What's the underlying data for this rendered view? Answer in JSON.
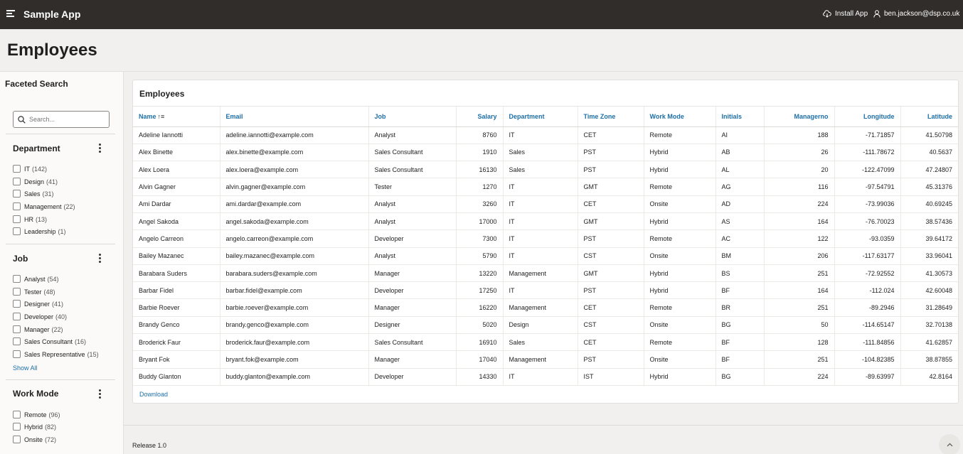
{
  "app": {
    "title": "Sample App",
    "install_label": "Install App",
    "user_email": "ben.jackson@dsp.co.uk"
  },
  "page": {
    "title": "Employees"
  },
  "sidebar": {
    "title": "Faceted Search",
    "search_placeholder": "Search...",
    "facets": [
      {
        "name": "Department",
        "options": [
          {
            "label": "IT",
            "count": "(142)"
          },
          {
            "label": "Design",
            "count": "(41)"
          },
          {
            "label": "Sales",
            "count": "(31)"
          },
          {
            "label": "Management",
            "count": "(22)"
          },
          {
            "label": "HR",
            "count": "(13)"
          },
          {
            "label": "Leadership",
            "count": "(1)"
          }
        ]
      },
      {
        "name": "Job",
        "options": [
          {
            "label": "Analyst",
            "count": "(54)"
          },
          {
            "label": "Tester",
            "count": "(48)"
          },
          {
            "label": "Designer",
            "count": "(41)"
          },
          {
            "label": "Developer",
            "count": "(40)"
          },
          {
            "label": "Manager",
            "count": "(22)"
          },
          {
            "label": "Sales Consultant",
            "count": "(16)"
          },
          {
            "label": "Sales Representative",
            "count": "(15)"
          }
        ],
        "show_all": "Show All"
      },
      {
        "name": "Work Mode",
        "options": [
          {
            "label": "Remote",
            "count": "(96)"
          },
          {
            "label": "Hybrid",
            "count": "(82)"
          },
          {
            "label": "Onsite",
            "count": "(72)"
          }
        ]
      }
    ]
  },
  "report": {
    "title": "Employees",
    "columns": [
      "Name",
      "Email",
      "Job",
      "Salary",
      "Department",
      "Time Zone",
      "Work Mode",
      "Initials",
      "Managerno",
      "Longitude",
      "Latitude"
    ],
    "rows": [
      [
        "Adeline Iannotti",
        "adeline.iannotti@example.com",
        "Analyst",
        "8760",
        "IT",
        "CET",
        "Remote",
        "AI",
        "188",
        "-71.71857",
        "41.50798"
      ],
      [
        "Alex Binette",
        "alex.binette@example.com",
        "Sales Consultant",
        "1910",
        "Sales",
        "PST",
        "Hybrid",
        "AB",
        "26",
        "-111.78672",
        "40.5637"
      ],
      [
        "Alex Loera",
        "alex.loera@example.com",
        "Sales Consultant",
        "16130",
        "Sales",
        "PST",
        "Hybrid",
        "AL",
        "20",
        "-122.47099",
        "47.24807"
      ],
      [
        "Alvin Gagner",
        "alvin.gagner@example.com",
        "Tester",
        "1270",
        "IT",
        "GMT",
        "Remote",
        "AG",
        "116",
        "-97.54791",
        "45.31376"
      ],
      [
        "Ami Dardar",
        "ami.dardar@example.com",
        "Analyst",
        "3260",
        "IT",
        "CET",
        "Onsite",
        "AD",
        "224",
        "-73.99036",
        "40.69245"
      ],
      [
        "Angel Sakoda",
        "angel.sakoda@example.com",
        "Analyst",
        "17000",
        "IT",
        "GMT",
        "Hybrid",
        "AS",
        "164",
        "-76.70023",
        "38.57436"
      ],
      [
        "Angelo Carreon",
        "angelo.carreon@example.com",
        "Developer",
        "7300",
        "IT",
        "PST",
        "Remote",
        "AC",
        "122",
        "-93.0359",
        "39.64172"
      ],
      [
        "Bailey Mazanec",
        "bailey.mazanec@example.com",
        "Analyst",
        "5790",
        "IT",
        "CST",
        "Onsite",
        "BM",
        "206",
        "-117.63177",
        "33.96041"
      ],
      [
        "Barabara Suders",
        "barabara.suders@example.com",
        "Manager",
        "13220",
        "Management",
        "GMT",
        "Hybrid",
        "BS",
        "251",
        "-72.92552",
        "41.30573"
      ],
      [
        "Barbar Fidel",
        "barbar.fidel@example.com",
        "Developer",
        "17250",
        "IT",
        "PST",
        "Hybrid",
        "BF",
        "164",
        "-112.024",
        "42.60048"
      ],
      [
        "Barbie Roever",
        "barbie.roever@example.com",
        "Manager",
        "16220",
        "Management",
        "CET",
        "Remote",
        "BR",
        "251",
        "-89.2946",
        "31.28649"
      ],
      [
        "Brandy Genco",
        "brandy.genco@example.com",
        "Designer",
        "5020",
        "Design",
        "CST",
        "Onsite",
        "BG",
        "50",
        "-114.65147",
        "32.70138"
      ],
      [
        "Broderick Faur",
        "broderick.faur@example.com",
        "Sales Consultant",
        "16910",
        "Sales",
        "CET",
        "Remote",
        "BF",
        "128",
        "-111.84856",
        "41.62857"
      ],
      [
        "Bryant Fok",
        "bryant.fok@example.com",
        "Manager",
        "17040",
        "Management",
        "PST",
        "Onsite",
        "BF",
        "251",
        "-104.82385",
        "38.87855"
      ],
      [
        "Buddy Glanton",
        "buddy.glanton@example.com",
        "Developer",
        "14330",
        "IT",
        "IST",
        "Hybrid",
        "BG",
        "224",
        "-89.63997",
        "42.8164"
      ]
    ],
    "download_label": "Download"
  },
  "footer": {
    "release": "Release 1.0"
  },
  "icons": {
    "menu": "hamburger-menu-icon",
    "install": "cloud-download-icon",
    "user": "user-icon",
    "search": "search-icon",
    "kebab": "kebab-menu-icon",
    "sort": "sort-ascending-icon",
    "top": "chevron-up-icon"
  }
}
